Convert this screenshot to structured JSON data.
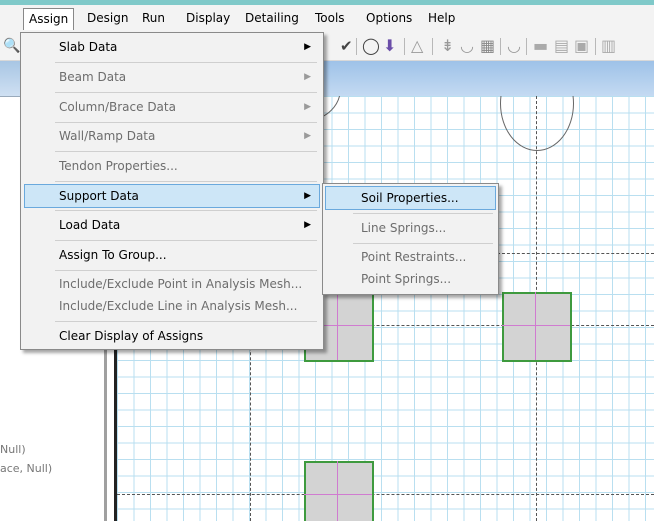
{
  "menubar": {
    "items": [
      "Assign",
      "Design",
      "Run",
      "Display",
      "Detailing",
      "Tools",
      "Options",
      "Help"
    ]
  },
  "toolbar": {
    "icons": [
      "zoom-icon",
      "check-icon",
      "circle-column-icon",
      "point-load-icon",
      "triangle-icon",
      "spring-icon",
      "slab-icon",
      "grid-icon",
      "beam-icon",
      "wall-icon",
      "tendon-icon",
      "area-icon",
      "settings-icon"
    ]
  },
  "left_panel": {
    "tree_lines": [
      "Null)",
      "ace, Null)"
    ]
  },
  "assign_menu": {
    "items": [
      {
        "label": "Slab Data",
        "arrow": "▶",
        "enabled": true
      },
      {
        "label": "Beam Data",
        "arrow": "▶",
        "enabled": false
      },
      {
        "label": "Column/Brace Data",
        "arrow": "▶",
        "enabled": false
      },
      {
        "label": "Wall/Ramp Data",
        "arrow": "▶",
        "enabled": false
      },
      {
        "label": "Tendon Properties...",
        "arrow": "",
        "enabled": false
      },
      {
        "label": "Support Data",
        "arrow": "▶",
        "enabled": true,
        "highlighted": true
      },
      {
        "label": "Load Data",
        "arrow": "▶",
        "enabled": true
      },
      {
        "label": "Assign To Group...",
        "arrow": "",
        "enabled": true
      },
      {
        "label": "Include/Exclude Point in Analysis Mesh...",
        "arrow": "",
        "enabled": false
      },
      {
        "label": "Include/Exclude Line in Analysis Mesh...",
        "arrow": "",
        "enabled": false
      },
      {
        "label": "Clear Display of Assigns",
        "arrow": "",
        "enabled": true
      }
    ]
  },
  "support_submenu": {
    "items": [
      {
        "label": "Soil Properties...",
        "enabled": true,
        "highlighted": true
      },
      {
        "label": "Line Springs...",
        "enabled": false
      },
      {
        "label": "Point Restraints...",
        "enabled": false
      },
      {
        "label": "Point Springs...",
        "enabled": false
      }
    ]
  },
  "colors": {
    "menu_highlight": "#cde6f7",
    "support_fill": "#d3d3d3",
    "support_border": "#3e9a3e",
    "grid_line": "#b9dff0",
    "canvas_header": "#9ec2e8"
  }
}
